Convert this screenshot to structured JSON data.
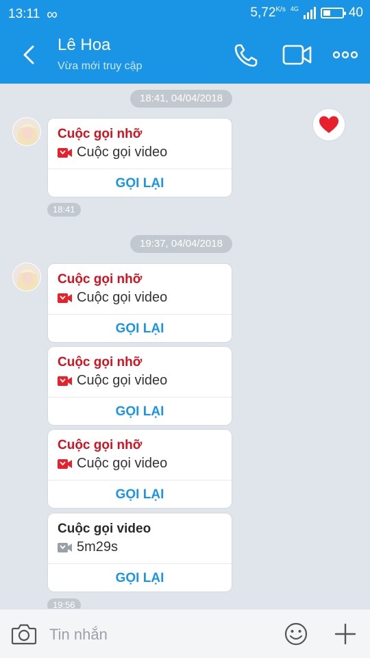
{
  "status_bar": {
    "time": "13:11",
    "loop_symbol": "∞",
    "net_speed": "5,72",
    "net_speed_unit": "K/s",
    "network_type": "4G",
    "battery": "40"
  },
  "header": {
    "contact_name": "Lê Hoa",
    "contact_status": "Vừa mới truy cập"
  },
  "colors": {
    "accent": "#1a95e6",
    "missed": "#d3121f",
    "chat_bg": "#dfe5ea"
  },
  "chat": {
    "groups": [
      {
        "date": "18:41, 04/04/2018",
        "time": "18:41",
        "cards": [
          {
            "title": "Cuộc gọi nhỡ",
            "sub": "Cuộc gọi video",
            "action": "GỌI LẠI",
            "missed": true
          }
        ]
      },
      {
        "date": "19:37, 04/04/2018",
        "time": "19:56",
        "cards": [
          {
            "title": "Cuộc gọi nhỡ",
            "sub": "Cuộc gọi video",
            "action": "GỌI LẠI",
            "missed": true
          },
          {
            "title": "Cuộc gọi nhỡ",
            "sub": "Cuộc gọi video",
            "action": "GỌI LẠI",
            "missed": true
          },
          {
            "title": "Cuộc gọi nhỡ",
            "sub": "Cuộc gọi video",
            "action": "GỌI LẠI",
            "missed": true
          },
          {
            "title": "Cuộc gọi video",
            "sub": "5m29s",
            "action": "GỌI LẠI",
            "missed": false
          }
        ]
      }
    ]
  },
  "input": {
    "placeholder": "Tin nhắn"
  },
  "icons": {
    "back": "chevron-left-icon",
    "call": "phone-icon",
    "video": "video-camera-icon",
    "more": "more-dots-icon",
    "reaction": "heart-icon",
    "camera": "camera-icon",
    "emoji": "emoji-icon",
    "plus": "plus-icon"
  }
}
